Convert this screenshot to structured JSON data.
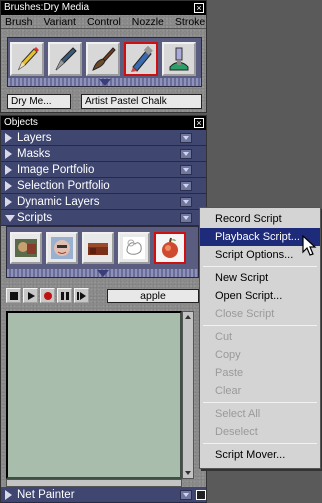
{
  "brushes": {
    "title": "Brushes:Dry Media",
    "close_glyph": "×",
    "menu": [
      "Brush",
      "Variant",
      "Control",
      "Nozzle",
      "Stroke"
    ],
    "tiles": [
      "pencil-brush-icon",
      "pen-nib-brush-icon",
      "paintbrush-icon",
      "pastel-chalk-brush-icon",
      "airbrush-icon"
    ],
    "selected_tile": 3,
    "category": "Dry Me...",
    "variant": "Artist Pastel Chalk"
  },
  "objects": {
    "title": "Objects",
    "sections": [
      {
        "label": "Layers",
        "open": false
      },
      {
        "label": "Masks",
        "open": false
      },
      {
        "label": "Image Portfolio",
        "open": false
      },
      {
        "label": "Selection Portfolio",
        "open": false
      },
      {
        "label": "Dynamic Layers",
        "open": false
      },
      {
        "label": "Scripts",
        "open": true
      }
    ],
    "script_tiles": [
      "photo-script-icon",
      "face-script-icon",
      "brick-script-icon",
      "sketch-script-icon",
      "apple-script-icon"
    ],
    "selected_script_tile": 4,
    "controls": [
      "stop",
      "play",
      "record",
      "pause",
      "step"
    ],
    "script_name": "apple",
    "bottom_section": "Net Painter"
  },
  "context_menu": {
    "groups": [
      [
        {
          "label": "Record Script",
          "enabled": true
        },
        {
          "label": "Playback Script...",
          "enabled": true,
          "highlighted": true
        },
        {
          "label": "Script Options...",
          "enabled": true
        }
      ],
      [
        {
          "label": "New Script",
          "enabled": true
        },
        {
          "label": "Open Script...",
          "enabled": true
        },
        {
          "label": "Close Script",
          "enabled": false
        }
      ],
      [
        {
          "label": "Cut",
          "enabled": false
        },
        {
          "label": "Copy",
          "enabled": false
        },
        {
          "label": "Paste",
          "enabled": false
        },
        {
          "label": "Clear",
          "enabled": false
        }
      ],
      [
        {
          "label": "Select All",
          "enabled": false
        },
        {
          "label": "Deselect",
          "enabled": false
        }
      ],
      [
        {
          "label": "Script Mover...",
          "enabled": true
        }
      ]
    ]
  },
  "colors": {
    "section_header": "#3f4670",
    "highlight": "#1e2a7a",
    "preview_bg": "#a8bdab",
    "selection_border": "#d01010"
  }
}
